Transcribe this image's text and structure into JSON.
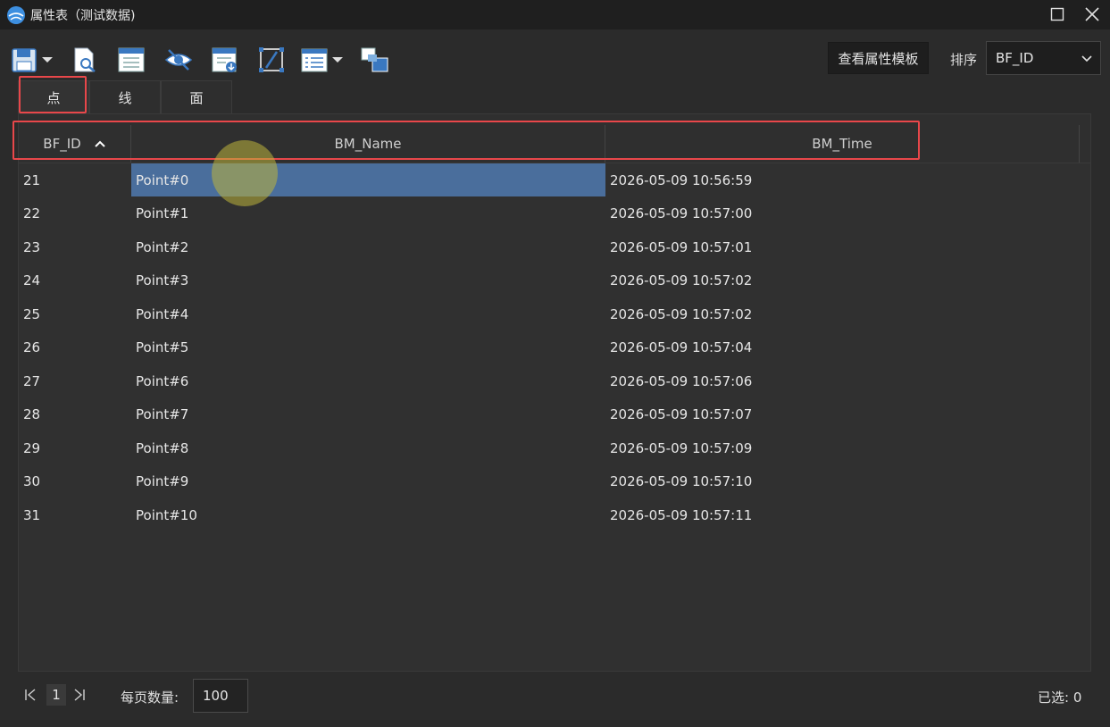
{
  "window": {
    "title": "属性表（测试数据)",
    "controls": [
      "maximize-icon",
      "close-icon"
    ]
  },
  "toolbar": {
    "icons": [
      "save-icon",
      "dropdown-arrow-icon",
      "document-search-icon",
      "table-filter-icon",
      "eye-hide-icon",
      "table-download-icon",
      "edit-frame-icon",
      "list-menu-icon",
      "dropdown-arrow-icon",
      "layers-icon"
    ],
    "view_template_label": "查看属性模板",
    "sort_label": "排序",
    "sort_value": "BF_ID"
  },
  "tabs": [
    {
      "label": "点",
      "active": true
    },
    {
      "label": "线",
      "active": false
    },
    {
      "label": "面",
      "active": false
    }
  ],
  "table": {
    "columns": [
      "BF_ID",
      "BM_Name",
      "BM_Time"
    ],
    "sorted_column": "BF_ID",
    "sort_direction": "ascending",
    "rows": [
      {
        "id": "21",
        "name": "Point#0",
        "time": "2026-05-09 10:56:59",
        "selected": true
      },
      {
        "id": "22",
        "name": "Point#1",
        "time": "2026-05-09 10:57:00"
      },
      {
        "id": "23",
        "name": "Point#2",
        "time": "2026-05-09 10:57:01"
      },
      {
        "id": "24",
        "name": "Point#3",
        "time": "2026-05-09 10:57:02"
      },
      {
        "id": "25",
        "name": "Point#4",
        "time": "2026-05-09 10:57:02"
      },
      {
        "id": "26",
        "name": "Point#5",
        "time": "2026-05-09 10:57:04"
      },
      {
        "id": "27",
        "name": "Point#6",
        "time": "2026-05-09 10:57:06"
      },
      {
        "id": "28",
        "name": "Point#7",
        "time": "2026-05-09 10:57:07"
      },
      {
        "id": "29",
        "name": "Point#8",
        "time": "2026-05-09 10:57:09"
      },
      {
        "id": "30",
        "name": "Point#9",
        "time": "2026-05-09 10:57:10"
      },
      {
        "id": "31",
        "name": "Point#10",
        "time": "2026-05-09 10:57:11"
      }
    ]
  },
  "footer": {
    "current_page": "1",
    "page_size_label": "每页数量:",
    "page_size_value": "100",
    "selected_label": "已选: 0"
  },
  "colors": {
    "highlight_border": "#e8474a",
    "selection": "#4a6e9c",
    "app_icon": "#3d8fe0"
  }
}
